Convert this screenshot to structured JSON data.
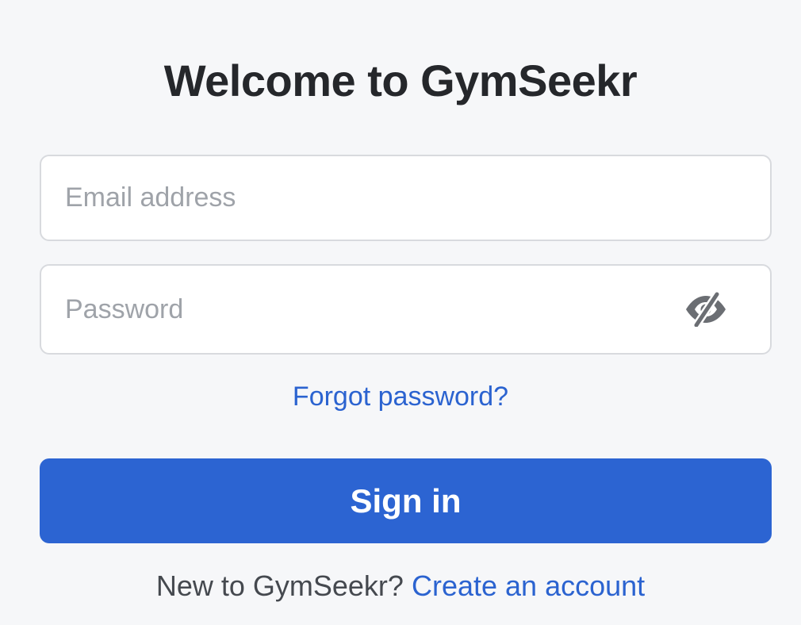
{
  "header": {
    "title": "Welcome to GymSeekr"
  },
  "form": {
    "email_placeholder": "Email address",
    "email_value": "",
    "password_placeholder": "Password",
    "password_value": "",
    "password_toggle_icon": "eye-slash-icon",
    "forgot_label": "Forgot password?",
    "submit_label": "Sign in"
  },
  "footer": {
    "prompt": "New to GymSeekr?",
    "link_label": "Create an account"
  },
  "colors": {
    "background": "#f6f7f9",
    "accent": "#2c64d2",
    "link": "#2b63d0",
    "title": "#25272b",
    "placeholder": "#9fa3a9",
    "border": "#d8dade"
  }
}
